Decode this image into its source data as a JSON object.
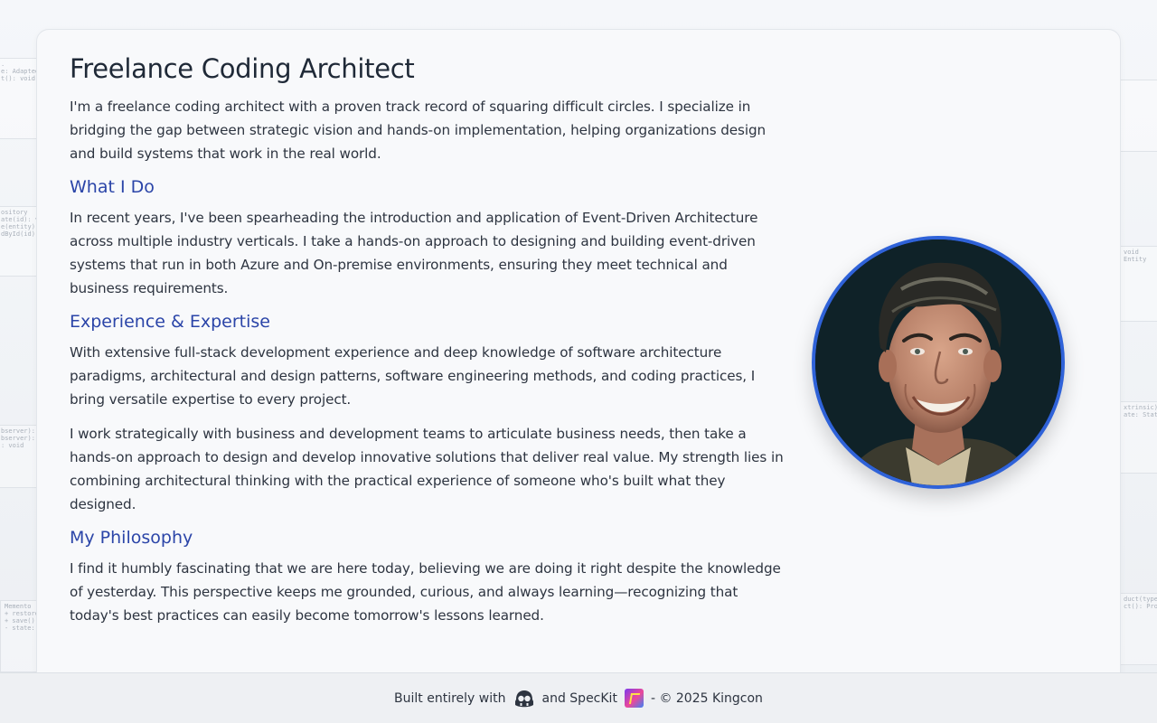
{
  "page": {
    "title": "Freelance Coding Architect",
    "intro": "I'm a freelance coding architect with a proven track record of squaring difficult circles. I specialize in bridging the gap between strategic vision and hands-on implementation, helping organizations design and build systems that work in the real world."
  },
  "sections": [
    {
      "heading": "What I Do",
      "paragraphs": [
        "In recent years, I've been spearheading the introduction and application of Event-Driven Architecture across multiple industry verticals. I take a hands-on approach to designing and building event-driven systems that run in both Azure and On-premise environments, ensuring they meet technical and business requirements."
      ]
    },
    {
      "heading": "Experience & Expertise",
      "paragraphs": [
        "With extensive full-stack development experience and deep knowledge of software architecture paradigms, architectural and design patterns, software engineering methods, and coding practices, I bring versatile expertise to every project.",
        "I work strategically with business and development teams to articulate business needs, then take a hands-on approach to design and develop innovative solutions that deliver real value. My strength lies in combining architectural thinking with the practical experience of someone who's built what they designed."
      ]
    },
    {
      "heading": "My Philosophy",
      "paragraphs": [
        "I find it humbly fascinating that we are here today, believing we are doing it right despite the knowledge of yesterday. This perspective keeps me grounded, curious, and always learning—recognizing that today's best practices can easily become tomorrow's lessons learned."
      ]
    }
  ],
  "footer": {
    "built_with": "Built entirely with",
    "and_speckit": "and SpecKit",
    "copyright": "- © 2025 Kingcon",
    "icons": [
      "github-copilot-icon",
      "speckit-icon"
    ]
  },
  "background": {
    "uml_snippets": [
      {
        "text": ".\ne: Adaptee\nt(): void"
      },
      {
        "text": "ository\nate(id): vo\ne(entity):\ndById(id):",
        "title": ""
      },
      {
        "text": "bserver):\nbserver):\n: void"
      },
      {
        "text": "Memento\n+ restore\n+ save():\n- state:"
      },
      {
        "text": "void\nEntity"
      },
      {
        "text": "xtrinsic):\nate: State"
      },
      {
        "text": "duct(type)\nct(): Produ"
      }
    ]
  },
  "colors": {
    "accent": "#2b45a8",
    "portrait_ring": "#2f62d8",
    "text": "#2d3440"
  }
}
